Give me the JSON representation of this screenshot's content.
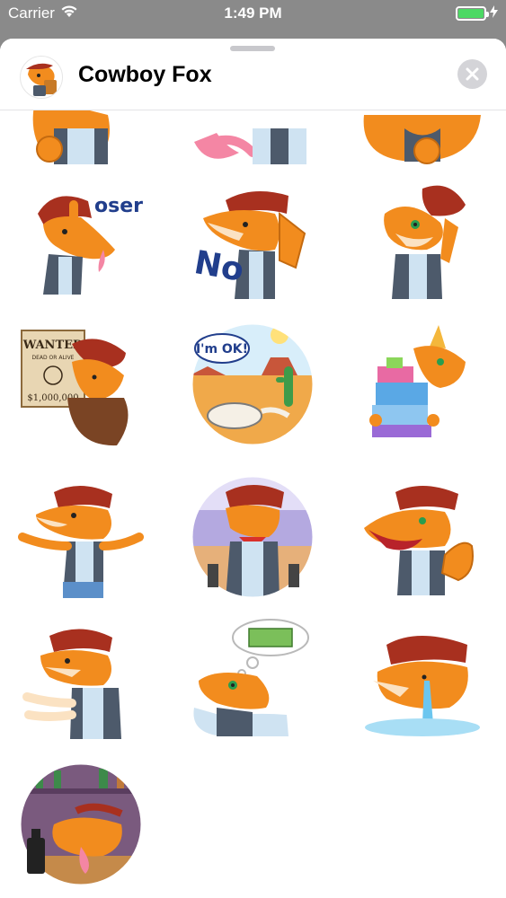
{
  "status_bar": {
    "carrier": "Carrier",
    "time": "1:49 PM",
    "battery_level": 1.0,
    "battery_color": "#4cd964"
  },
  "sheet": {
    "title": "Cowboy Fox",
    "icons": {
      "app": "fox-app-icon",
      "close": "close-icon",
      "wifi": "wifi-icon",
      "battery": "battery-icon",
      "charging": "bolt-icon"
    }
  },
  "stickers": {
    "row0": [
      "fox-thumbs",
      "fox-tongue-out",
      "fox-hand-on-chin"
    ],
    "items": [
      {
        "name": "sticker-loser",
        "text": "oser"
      },
      {
        "name": "sticker-no",
        "text": "No"
      },
      {
        "name": "sticker-tipping-hat",
        "text": ""
      },
      {
        "name": "sticker-wanted",
        "text": "WANTED",
        "sub": "DEAD OR ALIVE",
        "reward": "$1,000,000"
      },
      {
        "name": "sticker-im-ok",
        "text": "I'm OK!"
      },
      {
        "name": "sticker-party-gifts",
        "text": ""
      },
      {
        "name": "sticker-shrug",
        "text": ""
      },
      {
        "name": "sticker-gunslinger",
        "text": ""
      },
      {
        "name": "sticker-laughing-wave",
        "text": ""
      },
      {
        "name": "sticker-pointing",
        "text": ""
      },
      {
        "name": "sticker-thinking-money",
        "text": ""
      },
      {
        "name": "sticker-crying",
        "text": ""
      },
      {
        "name": "sticker-saloon-drunk",
        "text": ""
      }
    ]
  },
  "colors": {
    "fox_orange": "#f28c1e",
    "fox_light": "#fbe2c2",
    "hat_red": "#a8301f",
    "vest_gray": "#4d5a6b",
    "shirt_blue": "#cfe3f2",
    "jeans": "#5b8fc9"
  }
}
